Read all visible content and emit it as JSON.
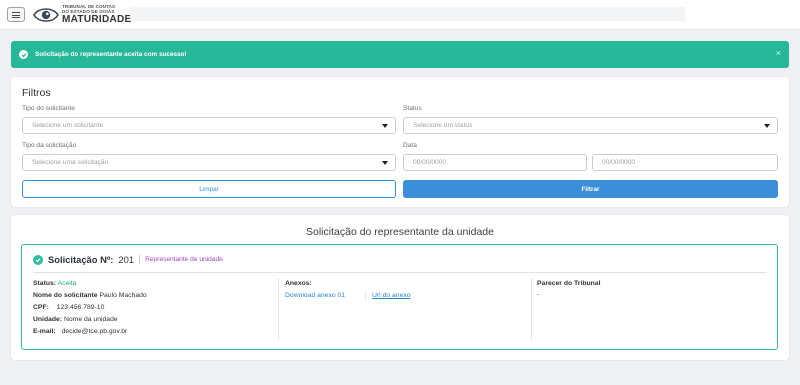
{
  "header": {
    "logo_line1": "TRIBUNAL DE CONTAS",
    "logo_line2": "DO ESTADO DE GOIÁS",
    "logo_main": "MATURIDADE"
  },
  "alert": {
    "message": "Solicitação do representante aceita com sucesso!",
    "close": "×"
  },
  "filters": {
    "title": "Filtros",
    "requester_type": {
      "label": "Tipo do solicitante",
      "placeholder": "Selecione um solicitante"
    },
    "status": {
      "label": "Status",
      "placeholder": "Selecione um status"
    },
    "request_type": {
      "label": "Tipo da solicitação",
      "placeholder": "Selecione uma solicitação"
    },
    "date": {
      "label": "Data",
      "from_placeholder": "00/00/0000",
      "to_placeholder": "00/00/0000"
    },
    "clear_label": "Limpar",
    "filter_label": "Filtrar"
  },
  "results": {
    "title": "Solicitação do representante da unidade",
    "request": {
      "label": "Solicitação Nº:",
      "number": "201",
      "type": "Representante de unidade",
      "status_label": "Status:",
      "status_value": "Aceita",
      "name_label": "Nome do solicitante",
      "name_value": "Paulo Machado",
      "cpf_label": "CPF:",
      "cpf_value": "123.456.789-10",
      "unit_label": "Unidade:",
      "unit_value": "Nome da unidade",
      "email_label": "E-mail:",
      "email_value": "decide@tce.pb.gov.br",
      "attachments_label": "Anexos:",
      "attachment_download": "Download anexo 01",
      "attachment_url": "Url do anexo",
      "opinion_label": "Parecer do Tribunal",
      "opinion_value": "-"
    }
  },
  "colors": {
    "success": "#27b89a",
    "primary": "#3b8fd9",
    "tag": "#a346b8"
  }
}
